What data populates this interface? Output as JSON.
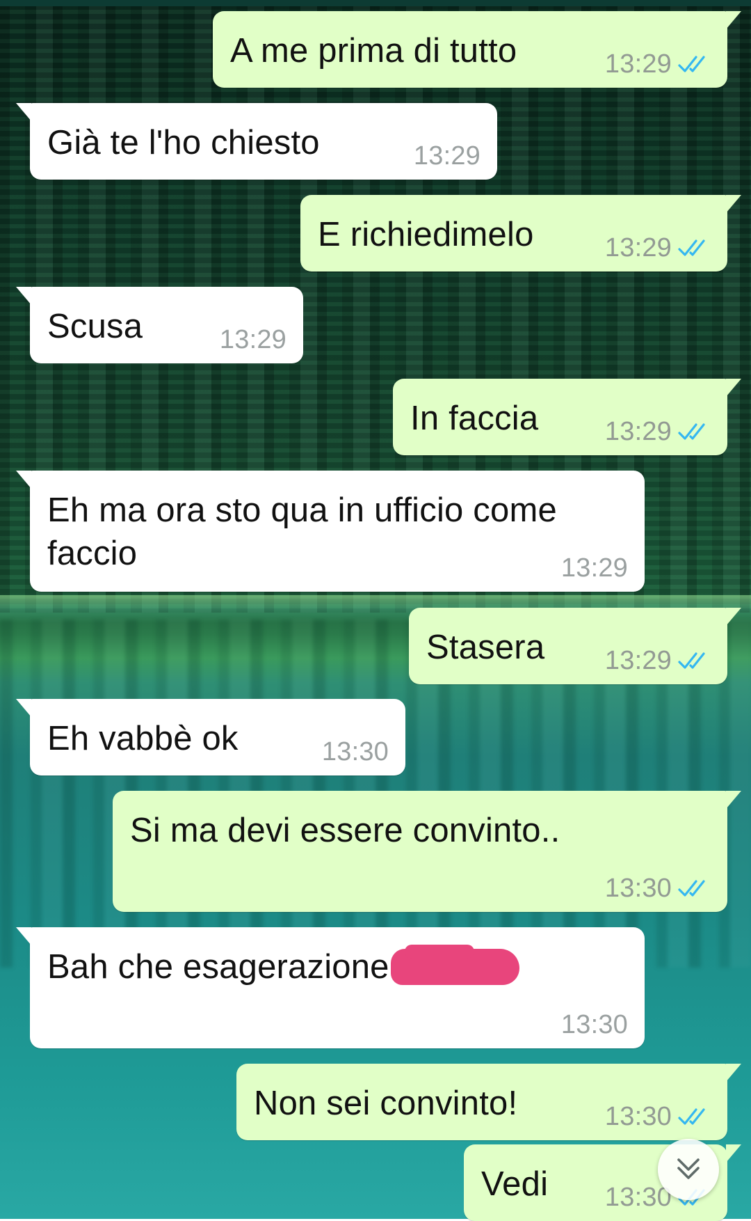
{
  "messages": [
    {
      "direction": "out",
      "text": "A me prima di tutto",
      "time": "13:29",
      "status": "read"
    },
    {
      "direction": "in",
      "text": "Già te l'ho chiesto",
      "time": "13:29"
    },
    {
      "direction": "out",
      "text": "E richiedimelo",
      "time": "13:29",
      "status": "read"
    },
    {
      "direction": "in",
      "text": "Scusa",
      "time": "13:29"
    },
    {
      "direction": "out",
      "text": "In faccia",
      "time": "13:29",
      "status": "read"
    },
    {
      "direction": "in",
      "text": "Eh ma ora sto qua in ufficio come faccio",
      "time": "13:29"
    },
    {
      "direction": "out",
      "text": "Stasera",
      "time": "13:29",
      "status": "read"
    },
    {
      "direction": "in",
      "text": "Eh vabbè ok",
      "time": "13:30"
    },
    {
      "direction": "out",
      "text": "Si ma devi essere convinto..",
      "time": "13:30",
      "status": "read"
    },
    {
      "direction": "in",
      "text": "Bah che esagerazione",
      "time": "13:30",
      "redacted_tail": true
    },
    {
      "direction": "out",
      "text": "Non sei convinto!",
      "time": "13:30",
      "status": "read"
    },
    {
      "direction": "out",
      "text": "Vedi",
      "time": "13:30",
      "status": "read"
    }
  ],
  "icons": {
    "read_receipt": "double-check-icon",
    "scroll_down": "chevron-double-down-icon"
  },
  "colors": {
    "outgoing_bubble": "#e1ffc7",
    "incoming_bubble": "#ffffff",
    "read_tick": "#34b7f1",
    "timestamp": "#929a93",
    "redaction": "#e8457c"
  }
}
